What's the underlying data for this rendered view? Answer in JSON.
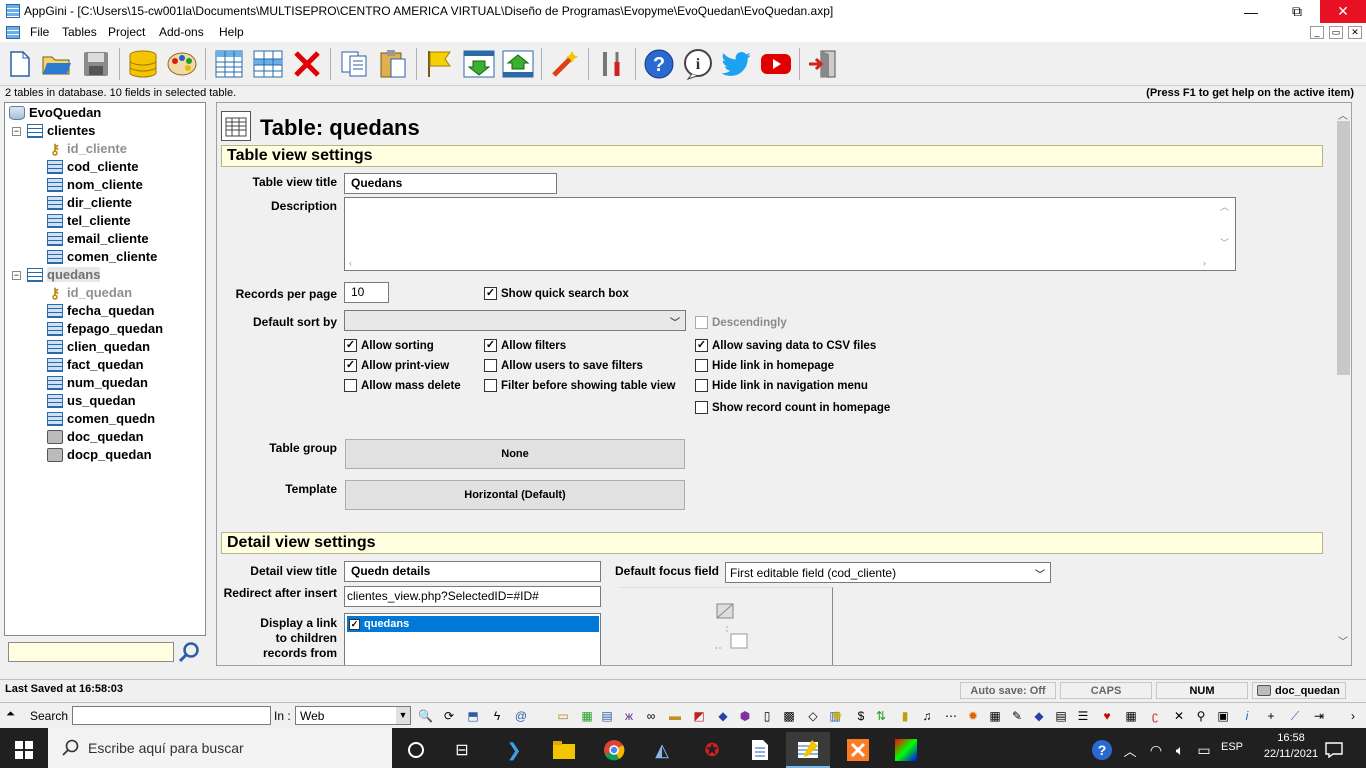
{
  "window": {
    "title": "AppGini - [C:\\Users\\15-cw001la\\Documents\\MULTISEPRO\\CENTRO AMERICA VIRTUAL\\Diseño de Programas\\Evopyme\\EvoQuedan\\EvoQuedan.axp]",
    "minimize": "—",
    "restore": "⧉",
    "close": "✕"
  },
  "menu": {
    "file": "File",
    "tables": "Tables",
    "project": "Project",
    "addons": "Add-ons",
    "help": "Help"
  },
  "infobar": {
    "left": "2 tables in database. 10 fields in selected table.",
    "right": "(Press F1 to get help on the active item)"
  },
  "tree": {
    "project": "EvoQuedan",
    "tables": [
      {
        "name": "clientes",
        "fields": [
          "id_cliente",
          "cod_cliente",
          "nom_cliente",
          "dir_cliente",
          "tel_cliente",
          "email_cliente",
          "comen_cliente"
        ]
      },
      {
        "name": "quedans",
        "fields": [
          "id_quedan",
          "fecha_quedan",
          "fepago_quedan",
          "clien_quedan",
          "fact_quedan",
          "num_quedan",
          "us_quedan",
          "comen_quedn",
          "doc_quedan",
          "docp_quedan"
        ]
      }
    ]
  },
  "panel": {
    "heading": "Table: quedans",
    "tv_section": "Table view settings",
    "tv_title_label": "Table view title",
    "tv_title_value": "Quedans",
    "description_label": "Description",
    "records_label": "Records per page",
    "records_value": "10",
    "quick_search": "Show quick search box",
    "sort_label": "Default sort by",
    "descendingly": "Descendingly",
    "allow_sorting": "Allow sorting",
    "allow_filters": "Allow filters",
    "allow_csv": "Allow saving data to CSV files",
    "allow_print": "Allow print-view",
    "allow_save_filters": "Allow users to save filters",
    "hide_homepage": "Hide link in homepage",
    "allow_mass_delete": "Allow mass delete",
    "filter_before": "Filter before showing table view",
    "hide_nav": "Hide link in navigation menu",
    "show_count": "Show record count in homepage",
    "group_label": "Table group",
    "group_value": "None",
    "template_label": "Template",
    "template_value": "Horizontal (Default)",
    "dv_section": "Detail view settings",
    "dv_title_label": "Detail view title",
    "dv_title_value": "Quedn details",
    "focus_label": "Default focus field",
    "focus_value": "First editable field (cod_cliente)",
    "redirect_label": "Redirect after insert",
    "redirect_value": "clientes_view.php?SelectedID=#ID#",
    "children_label_1": "Display a link",
    "children_label_2": "to children",
    "children_label_3": "records from",
    "children_item": "quedans"
  },
  "status": {
    "saved": "Last Saved at 16:58:03",
    "autosave": "Auto save: Off",
    "caps": "CAPS",
    "num": "NUM",
    "field": "doc_quedan"
  },
  "quickbar": {
    "search_label": "Search :",
    "in_label": "In :",
    "in_value": "Web"
  },
  "taskbar": {
    "search_placeholder": "Escribe aquí para buscar",
    "lang": "ESP",
    "time": "16:58",
    "date": "22/11/2021"
  }
}
